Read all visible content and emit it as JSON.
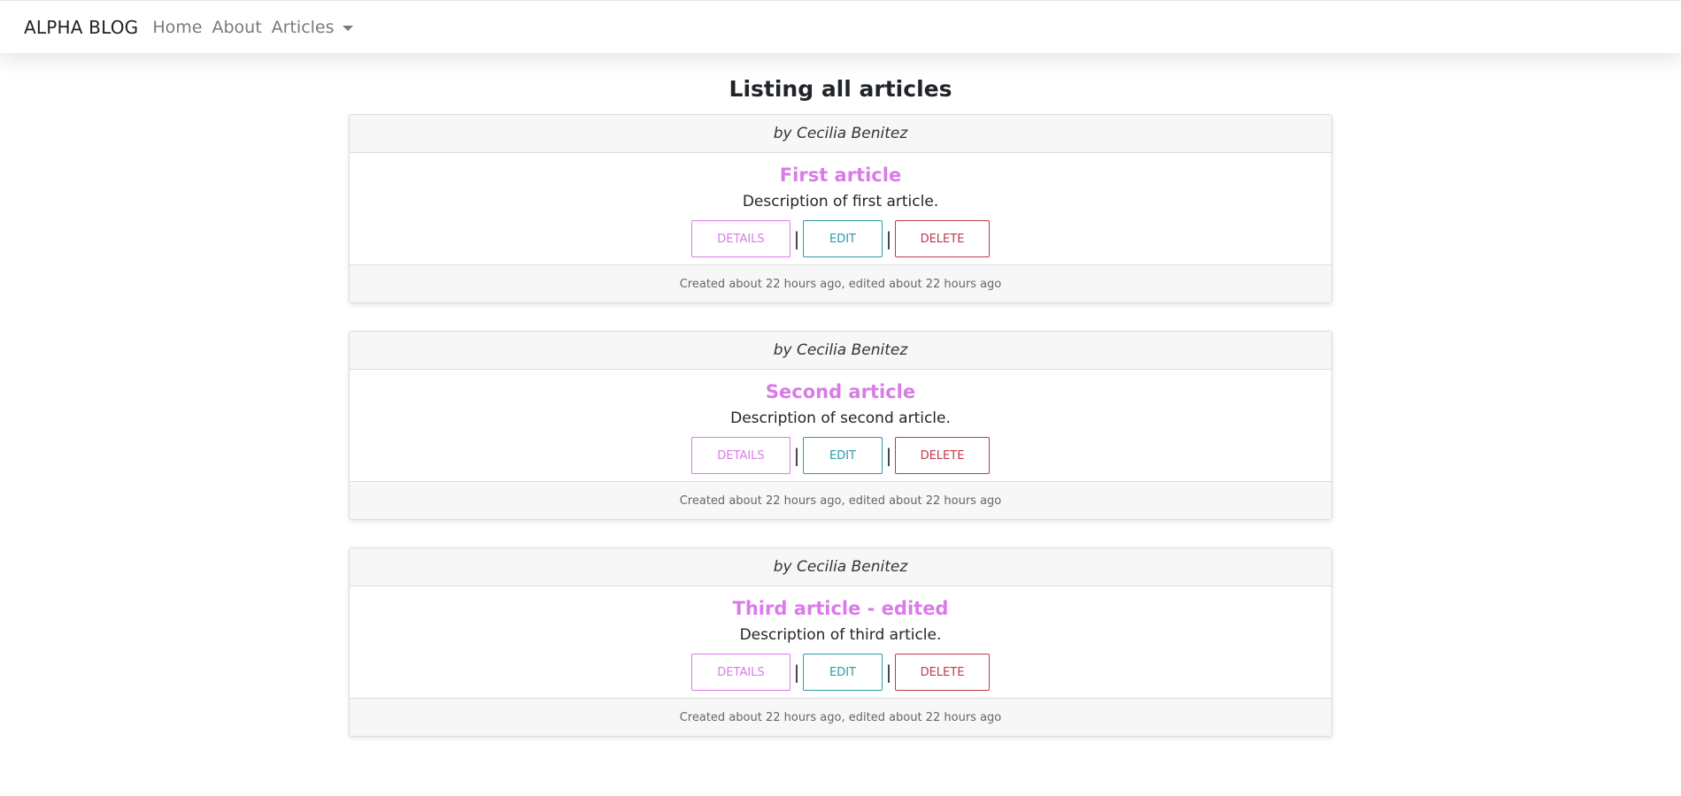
{
  "navbar": {
    "brand": "ALPHA BLOG",
    "links": [
      "Home",
      "About"
    ],
    "dropdown_label": "Articles"
  },
  "page_title": "Listing all articles",
  "articles": [
    {
      "author": "by Cecilia Benitez",
      "title": "First article",
      "description": "Description of first article.",
      "details_label": "DETAILS",
      "edit_label": "EDIT",
      "delete_label": "DELETE",
      "footer": "Created about 22 hours ago, edited about 22 hours ago"
    },
    {
      "author": "by Cecilia Benitez",
      "title": "Second article",
      "description": "Description of second article.",
      "details_label": "DETAILS",
      "edit_label": "EDIT",
      "delete_label": "DELETE",
      "footer": "Created about 22 hours ago, edited about 22 hours ago"
    },
    {
      "author": "by Cecilia Benitez",
      "title": "Third article - edited",
      "description": "Description of third article.",
      "details_label": "DETAILS",
      "edit_label": "EDIT",
      "delete_label": "DELETE",
      "footer": "Created about 22 hours ago, edited about 22 hours ago"
    }
  ],
  "separator": "|",
  "colors": {
    "accent": "#d97be8",
    "edit": "#2a9aa8",
    "delete": "#c0394b"
  }
}
